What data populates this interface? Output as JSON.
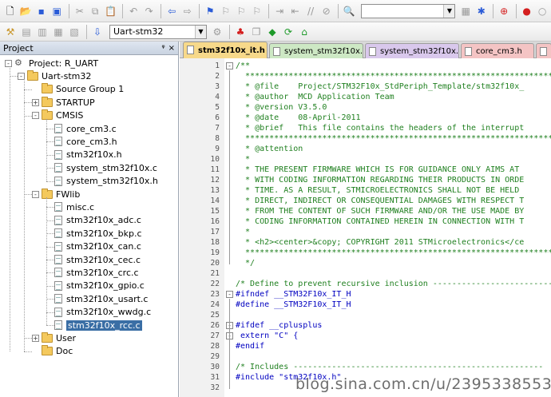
{
  "toolbar1": {
    "icons": [
      "new-file",
      "open-folder",
      "save",
      "save-all",
      "cut",
      "copy",
      "paste",
      "undo",
      "redo",
      "nav-back",
      "nav-forward",
      "bookmark",
      "bookmark-prev",
      "bookmark-next",
      "bookmark-clear",
      "indent",
      "unindent",
      "comment",
      "uncomment",
      "find-in-files",
      "find-combo",
      "find",
      "config",
      "debug",
      "stop-build",
      "breakpoint"
    ],
    "find_value": ""
  },
  "toolbar2": {
    "icons": [
      "translate",
      "build",
      "rebuild",
      "batch-build",
      "download",
      "target-options"
    ],
    "target_value": "Uart-stm32"
  },
  "project_panel": {
    "title": "Project",
    "pin_glyph": "ᵠ",
    "close_glyph": "×",
    "tree": [
      {
        "label": "Project: R_UART",
        "level": 0,
        "type": "project",
        "expander": "-"
      },
      {
        "label": "Uart-stm32",
        "level": 1,
        "type": "target",
        "expander": "-"
      },
      {
        "label": "Source Group 1",
        "level": 2,
        "type": "folder",
        "expander": ""
      },
      {
        "label": "STARTUP",
        "level": 2,
        "type": "folder",
        "expander": "+"
      },
      {
        "label": "CMSIS",
        "level": 2,
        "type": "folder",
        "expander": "-"
      },
      {
        "label": "core_cm3.c",
        "level": 3,
        "type": "file",
        "expander": ""
      },
      {
        "label": "core_cm3.h",
        "level": 3,
        "type": "file",
        "expander": ""
      },
      {
        "label": "stm32f10x.h",
        "level": 3,
        "type": "file",
        "expander": ""
      },
      {
        "label": "system_stm32f10x.c",
        "level": 3,
        "type": "file",
        "expander": ""
      },
      {
        "label": "system_stm32f10x.h",
        "level": 3,
        "type": "file",
        "expander": ""
      },
      {
        "label": "FWlib",
        "level": 2,
        "type": "folder",
        "expander": "-"
      },
      {
        "label": "misc.c",
        "level": 3,
        "type": "file",
        "expander": ""
      },
      {
        "label": "stm32f10x_adc.c",
        "level": 3,
        "type": "file",
        "expander": ""
      },
      {
        "label": "stm32f10x_bkp.c",
        "level": 3,
        "type": "file",
        "expander": ""
      },
      {
        "label": "stm32f10x_can.c",
        "level": 3,
        "type": "file",
        "expander": ""
      },
      {
        "label": "stm32f10x_cec.c",
        "level": 3,
        "type": "file",
        "expander": ""
      },
      {
        "label": "stm32f10x_crc.c",
        "level": 3,
        "type": "file",
        "expander": ""
      },
      {
        "label": "stm32f10x_gpio.c",
        "level": 3,
        "type": "file",
        "expander": ""
      },
      {
        "label": "stm32f10x_usart.c",
        "level": 3,
        "type": "file",
        "expander": ""
      },
      {
        "label": "stm32f10x_wwdg.c",
        "level": 3,
        "type": "file",
        "expander": ""
      },
      {
        "label": "stm32f10x_rcc.c",
        "level": 3,
        "type": "file",
        "expander": "",
        "selected": true
      },
      {
        "label": "User",
        "level": 2,
        "type": "folder",
        "expander": "+"
      },
      {
        "label": "Doc",
        "level": 2,
        "type": "folder",
        "expander": ""
      }
    ]
  },
  "editor": {
    "tabs": [
      {
        "label": "stm32f10x_it.h",
        "color": "#f7d98a",
        "active": true
      },
      {
        "label": "system_stm32f10x.h",
        "color": "#cde8c4",
        "active": false
      },
      {
        "label": "system_stm32f10x.c",
        "color": "#d9c8ec",
        "active": false
      },
      {
        "label": "core_cm3.h",
        "color": "#f4c4c4",
        "active": false
      },
      {
        "label": "m",
        "color": "#f4c4c4",
        "active": false
      }
    ],
    "lines": [
      {
        "n": "1",
        "fold": "-",
        "cls": "c-comment",
        "text": "/**"
      },
      {
        "n": "2",
        "fold": "",
        "cls": "c-comment",
        "text": "  ******************************************************************************"
      },
      {
        "n": "3",
        "fold": "",
        "cls": "c-comment",
        "text": "  * @file    Project/STM32F10x_StdPeriph_Template/stm32f10x_"
      },
      {
        "n": "4",
        "fold": "",
        "cls": "c-comment",
        "text": "  * @author  MCD Application Team"
      },
      {
        "n": "5",
        "fold": "",
        "cls": "c-comment",
        "text": "  * @version V3.5.0"
      },
      {
        "n": "6",
        "fold": "",
        "cls": "c-comment",
        "text": "  * @date    08-April-2011"
      },
      {
        "n": "7",
        "fold": "",
        "cls": "c-comment",
        "text": "  * @brief   This file contains the headers of the interrupt"
      },
      {
        "n": "8",
        "fold": "",
        "cls": "c-comment",
        "text": "  ******************************************************************************"
      },
      {
        "n": "9",
        "fold": "",
        "cls": "c-comment",
        "text": "  * @attention"
      },
      {
        "n": "10",
        "fold": "",
        "cls": "c-comment",
        "text": "  *"
      },
      {
        "n": "11",
        "fold": "",
        "cls": "c-comment",
        "text": "  * THE PRESENT FIRMWARE WHICH IS FOR GUIDANCE ONLY AIMS AT"
      },
      {
        "n": "12",
        "fold": "",
        "cls": "c-comment",
        "text": "  * WITH CODING INFORMATION REGARDING THEIR PRODUCTS IN ORDE"
      },
      {
        "n": "13",
        "fold": "",
        "cls": "c-comment",
        "text": "  * TIME. AS A RESULT, STMICROELECTRONICS SHALL NOT BE HELD"
      },
      {
        "n": "14",
        "fold": "",
        "cls": "c-comment",
        "text": "  * DIRECT, INDIRECT OR CONSEQUENTIAL DAMAGES WITH RESPECT T"
      },
      {
        "n": "15",
        "fold": "",
        "cls": "c-comment",
        "text": "  * FROM THE CONTENT OF SUCH FIRMWARE AND/OR THE USE MADE BY"
      },
      {
        "n": "16",
        "fold": "",
        "cls": "c-comment",
        "text": "  * CODING INFORMATION CONTAINED HEREIN IN CONNECTION WITH T"
      },
      {
        "n": "17",
        "fold": "",
        "cls": "c-comment",
        "text": "  *"
      },
      {
        "n": "18",
        "fold": "",
        "cls": "c-comment",
        "text": "  * <h2><center>&copy; COPYRIGHT 2011 STMicroelectronics</ce"
      },
      {
        "n": "19",
        "fold": "",
        "cls": "c-comment",
        "text": "  ******************************************************************************"
      },
      {
        "n": "20",
        "fold": "",
        "cls": "c-comment",
        "text": "  */"
      },
      {
        "n": "21",
        "fold": "",
        "cls": "c-plain",
        "text": ""
      },
      {
        "n": "22",
        "fold": "",
        "cls": "c-comment",
        "text": "/* Define to prevent recursive inclusion -------------------------"
      },
      {
        "n": "23",
        "fold": "-",
        "cls": "c-pre",
        "text": "#ifndef __STM32F10x_IT_H"
      },
      {
        "n": "24",
        "fold": "",
        "cls": "c-pre",
        "text": "#define __STM32F10x_IT_H"
      },
      {
        "n": "25",
        "fold": "",
        "cls": "c-plain",
        "text": ""
      },
      {
        "n": "26",
        "fold": "-",
        "cls": "c-pre",
        "text": "#ifdef __cplusplus"
      },
      {
        "n": "27",
        "fold": "-",
        "cls": "c-kw",
        "text": " extern \"C\" {"
      },
      {
        "n": "28",
        "fold": "",
        "cls": "c-pre",
        "text": "#endif"
      },
      {
        "n": "29",
        "fold": "",
        "cls": "c-plain",
        "text": ""
      },
      {
        "n": "30",
        "fold": "",
        "cls": "c-comment",
        "text": "/* Includes ----------------------------------------------------"
      },
      {
        "n": "31",
        "fold": "",
        "cls": "c-pre",
        "text": "#include \"stm32f10x.h\""
      },
      {
        "n": "32",
        "fold": "",
        "cls": "c-plain",
        "text": ""
      }
    ]
  },
  "watermark": "blog.sina.com.cn/u/2395338553"
}
